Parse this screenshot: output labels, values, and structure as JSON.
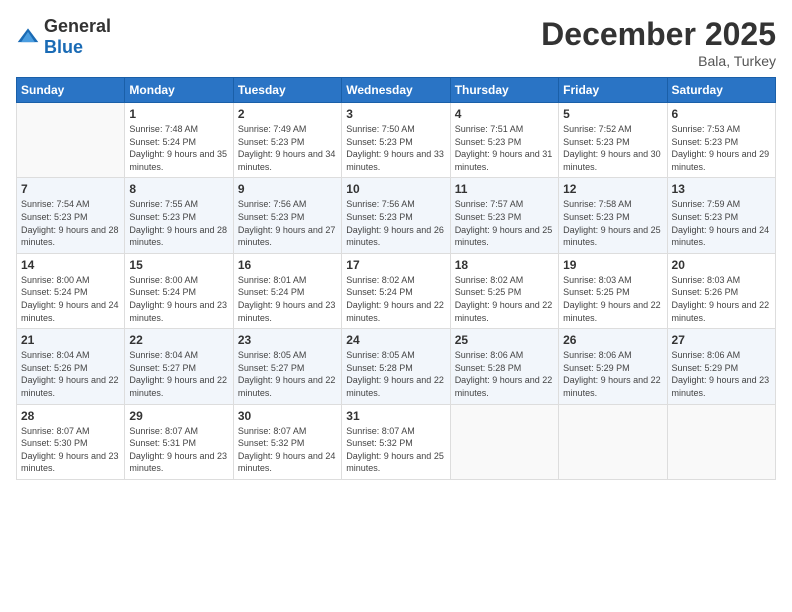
{
  "header": {
    "logo_general": "General",
    "logo_blue": "Blue",
    "month": "December 2025",
    "location": "Bala, Turkey"
  },
  "weekdays": [
    "Sunday",
    "Monday",
    "Tuesday",
    "Wednesday",
    "Thursday",
    "Friday",
    "Saturday"
  ],
  "weeks": [
    [
      {
        "day": "",
        "sunrise": "",
        "sunset": "",
        "daylight": ""
      },
      {
        "day": "1",
        "sunrise": "Sunrise: 7:48 AM",
        "sunset": "Sunset: 5:24 PM",
        "daylight": "Daylight: 9 hours and 35 minutes."
      },
      {
        "day": "2",
        "sunrise": "Sunrise: 7:49 AM",
        "sunset": "Sunset: 5:23 PM",
        "daylight": "Daylight: 9 hours and 34 minutes."
      },
      {
        "day": "3",
        "sunrise": "Sunrise: 7:50 AM",
        "sunset": "Sunset: 5:23 PM",
        "daylight": "Daylight: 9 hours and 33 minutes."
      },
      {
        "day": "4",
        "sunrise": "Sunrise: 7:51 AM",
        "sunset": "Sunset: 5:23 PM",
        "daylight": "Daylight: 9 hours and 31 minutes."
      },
      {
        "day": "5",
        "sunrise": "Sunrise: 7:52 AM",
        "sunset": "Sunset: 5:23 PM",
        "daylight": "Daylight: 9 hours and 30 minutes."
      },
      {
        "day": "6",
        "sunrise": "Sunrise: 7:53 AM",
        "sunset": "Sunset: 5:23 PM",
        "daylight": "Daylight: 9 hours and 29 minutes."
      }
    ],
    [
      {
        "day": "7",
        "sunrise": "Sunrise: 7:54 AM",
        "sunset": "Sunset: 5:23 PM",
        "daylight": "Daylight: 9 hours and 28 minutes."
      },
      {
        "day": "8",
        "sunrise": "Sunrise: 7:55 AM",
        "sunset": "Sunset: 5:23 PM",
        "daylight": "Daylight: 9 hours and 28 minutes."
      },
      {
        "day": "9",
        "sunrise": "Sunrise: 7:56 AM",
        "sunset": "Sunset: 5:23 PM",
        "daylight": "Daylight: 9 hours and 27 minutes."
      },
      {
        "day": "10",
        "sunrise": "Sunrise: 7:56 AM",
        "sunset": "Sunset: 5:23 PM",
        "daylight": "Daylight: 9 hours and 26 minutes."
      },
      {
        "day": "11",
        "sunrise": "Sunrise: 7:57 AM",
        "sunset": "Sunset: 5:23 PM",
        "daylight": "Daylight: 9 hours and 25 minutes."
      },
      {
        "day": "12",
        "sunrise": "Sunrise: 7:58 AM",
        "sunset": "Sunset: 5:23 PM",
        "daylight": "Daylight: 9 hours and 25 minutes."
      },
      {
        "day": "13",
        "sunrise": "Sunrise: 7:59 AM",
        "sunset": "Sunset: 5:23 PM",
        "daylight": "Daylight: 9 hours and 24 minutes."
      }
    ],
    [
      {
        "day": "14",
        "sunrise": "Sunrise: 8:00 AM",
        "sunset": "Sunset: 5:24 PM",
        "daylight": "Daylight: 9 hours and 24 minutes."
      },
      {
        "day": "15",
        "sunrise": "Sunrise: 8:00 AM",
        "sunset": "Sunset: 5:24 PM",
        "daylight": "Daylight: 9 hours and 23 minutes."
      },
      {
        "day": "16",
        "sunrise": "Sunrise: 8:01 AM",
        "sunset": "Sunset: 5:24 PM",
        "daylight": "Daylight: 9 hours and 23 minutes."
      },
      {
        "day": "17",
        "sunrise": "Sunrise: 8:02 AM",
        "sunset": "Sunset: 5:24 PM",
        "daylight": "Daylight: 9 hours and 22 minutes."
      },
      {
        "day": "18",
        "sunrise": "Sunrise: 8:02 AM",
        "sunset": "Sunset: 5:25 PM",
        "daylight": "Daylight: 9 hours and 22 minutes."
      },
      {
        "day": "19",
        "sunrise": "Sunrise: 8:03 AM",
        "sunset": "Sunset: 5:25 PM",
        "daylight": "Daylight: 9 hours and 22 minutes."
      },
      {
        "day": "20",
        "sunrise": "Sunrise: 8:03 AM",
        "sunset": "Sunset: 5:26 PM",
        "daylight": "Daylight: 9 hours and 22 minutes."
      }
    ],
    [
      {
        "day": "21",
        "sunrise": "Sunrise: 8:04 AM",
        "sunset": "Sunset: 5:26 PM",
        "daylight": "Daylight: 9 hours and 22 minutes."
      },
      {
        "day": "22",
        "sunrise": "Sunrise: 8:04 AM",
        "sunset": "Sunset: 5:27 PM",
        "daylight": "Daylight: 9 hours and 22 minutes."
      },
      {
        "day": "23",
        "sunrise": "Sunrise: 8:05 AM",
        "sunset": "Sunset: 5:27 PM",
        "daylight": "Daylight: 9 hours and 22 minutes."
      },
      {
        "day": "24",
        "sunrise": "Sunrise: 8:05 AM",
        "sunset": "Sunset: 5:28 PM",
        "daylight": "Daylight: 9 hours and 22 minutes."
      },
      {
        "day": "25",
        "sunrise": "Sunrise: 8:06 AM",
        "sunset": "Sunset: 5:28 PM",
        "daylight": "Daylight: 9 hours and 22 minutes."
      },
      {
        "day": "26",
        "sunrise": "Sunrise: 8:06 AM",
        "sunset": "Sunset: 5:29 PM",
        "daylight": "Daylight: 9 hours and 22 minutes."
      },
      {
        "day": "27",
        "sunrise": "Sunrise: 8:06 AM",
        "sunset": "Sunset: 5:29 PM",
        "daylight": "Daylight: 9 hours and 23 minutes."
      }
    ],
    [
      {
        "day": "28",
        "sunrise": "Sunrise: 8:07 AM",
        "sunset": "Sunset: 5:30 PM",
        "daylight": "Daylight: 9 hours and 23 minutes."
      },
      {
        "day": "29",
        "sunrise": "Sunrise: 8:07 AM",
        "sunset": "Sunset: 5:31 PM",
        "daylight": "Daylight: 9 hours and 23 minutes."
      },
      {
        "day": "30",
        "sunrise": "Sunrise: 8:07 AM",
        "sunset": "Sunset: 5:32 PM",
        "daylight": "Daylight: 9 hours and 24 minutes."
      },
      {
        "day": "31",
        "sunrise": "Sunrise: 8:07 AM",
        "sunset": "Sunset: 5:32 PM",
        "daylight": "Daylight: 9 hours and 25 minutes."
      },
      {
        "day": "",
        "sunrise": "",
        "sunset": "",
        "daylight": ""
      },
      {
        "day": "",
        "sunrise": "",
        "sunset": "",
        "daylight": ""
      },
      {
        "day": "",
        "sunrise": "",
        "sunset": "",
        "daylight": ""
      }
    ]
  ]
}
